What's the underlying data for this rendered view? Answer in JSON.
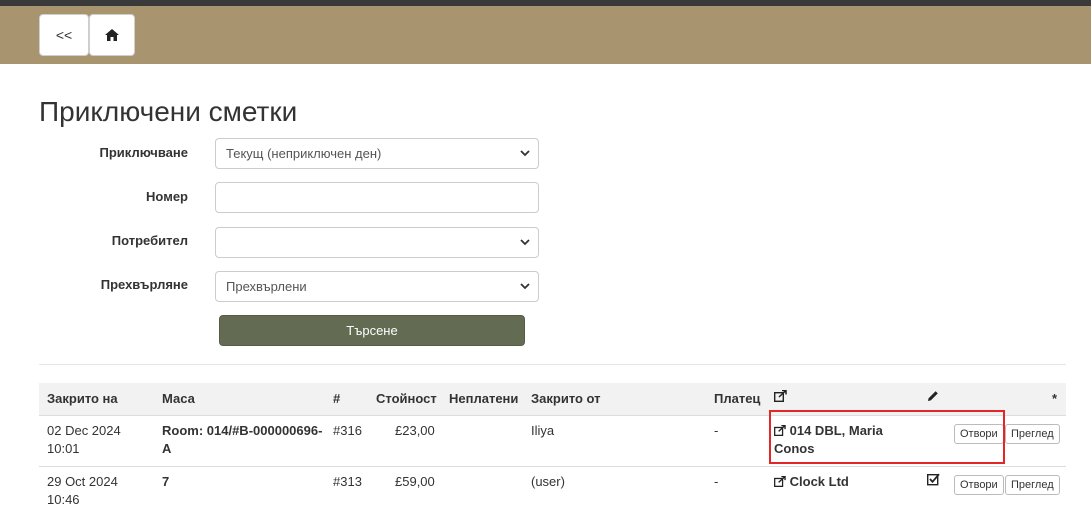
{
  "nav": {
    "back_label": "<<",
    "home_icon": "home-icon"
  },
  "page": {
    "title": "Приключени сметки"
  },
  "filters": {
    "closing": {
      "label": "Приключване",
      "value": "Текущ (неприключен ден)"
    },
    "number": {
      "label": "Номер",
      "value": ""
    },
    "user": {
      "label": "Потребител",
      "value": ""
    },
    "transfer": {
      "label": "Прехвърляне",
      "value": "Прехвърлени"
    },
    "search_label": "Търсене"
  },
  "table": {
    "headers": {
      "closed_on": "Закрито на",
      "table": "Маса",
      "number": "#",
      "value": "Стойност",
      "unpaid": "Неплатени",
      "closed_by": "Закрито от",
      "payer": "Платец",
      "transfer_icon": "external-link-icon",
      "edit_icon": "pencil-icon",
      "star": "*"
    },
    "rows": [
      {
        "date": "02 Dec 2024",
        "time": "10:01",
        "table_line1": "Room: 014/#B-000000696-",
        "table_line2": "A",
        "number": "#316",
        "value": "£23,00",
        "unpaid": "",
        "closed_by": "Iliya",
        "payer": "-",
        "transfer_line1": "014 DBL, Maria",
        "transfer_line2": "Conos",
        "checked": false,
        "open_label": "Отвори",
        "view_label": "Преглед"
      },
      {
        "date": "29 Oct 2024",
        "time": "10:46",
        "table_line1": "7",
        "table_line2": "",
        "number": "#313",
        "value": "£59,00",
        "unpaid": "",
        "closed_by": "(user)",
        "payer": "-",
        "transfer_line1": "Clock Ltd",
        "transfer_line2": "",
        "checked": true,
        "open_label": "Отвори",
        "view_label": "Преглед"
      }
    ]
  },
  "colors": {
    "navbar": "#a8946e",
    "search_button": "#636b53",
    "highlight": "#e32626"
  }
}
